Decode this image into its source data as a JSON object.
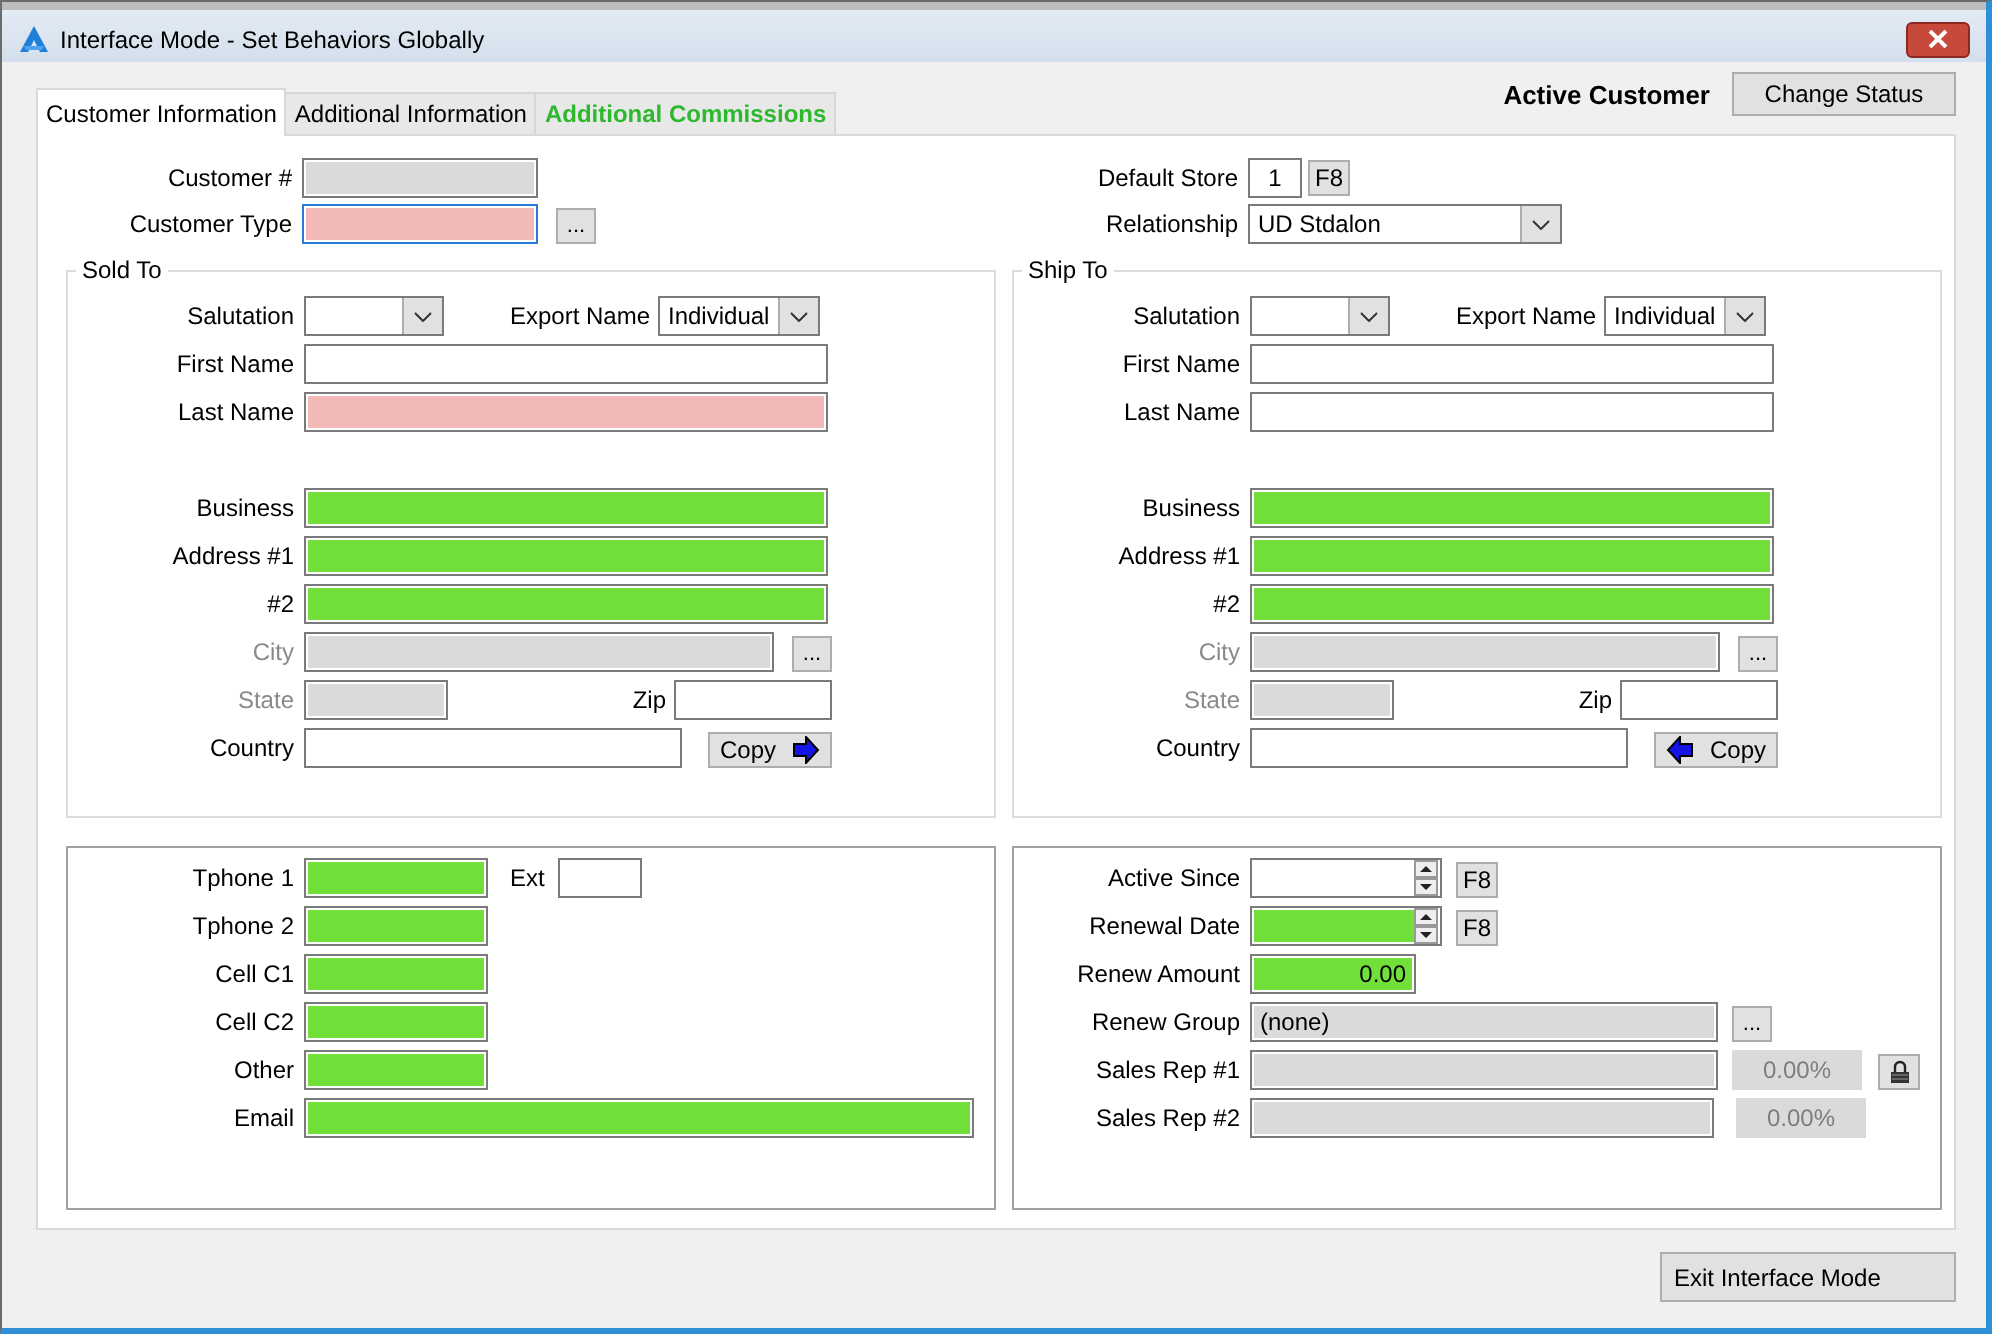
{
  "window": {
    "title": "Interface Mode - Set Behaviors Globally"
  },
  "tabs": [
    {
      "label": "Customer Information",
      "selected": true,
      "flagged": false
    },
    {
      "label": "Additional Information",
      "selected": false,
      "flagged": false
    },
    {
      "label": "Additional Commissions",
      "selected": false,
      "flagged": true
    }
  ],
  "header": {
    "status": "Active Customer",
    "change_status_button": "Change Status"
  },
  "account": {
    "customer_number": {
      "label": "Customer #",
      "disabled": true
    },
    "customer_type": {
      "label": "Customer Type",
      "required": true,
      "focused": true,
      "lookup_button": "..."
    },
    "default_store": {
      "label": "Default Store",
      "value": "1",
      "lookup_button": "F8"
    },
    "relationship": {
      "label": "Relationship",
      "value": "UD Stdalon"
    }
  },
  "sold_to": {
    "title": "Sold To",
    "salutation": {
      "label": "Salutation"
    },
    "export_name": {
      "label": "Export Name",
      "value": "Individual"
    },
    "first_name": {
      "label": "First Name"
    },
    "last_name": {
      "label": "Last Name",
      "required": true
    },
    "business": {
      "label": "Business",
      "flagged": true
    },
    "address_1": {
      "label": "Address #1",
      "flagged": true
    },
    "address_2": {
      "label": "#2",
      "flagged": true
    },
    "city": {
      "label": "City",
      "disabled": true,
      "label_dimmed": true,
      "lookup_button": "..."
    },
    "state": {
      "label": "State",
      "disabled": true,
      "label_dimmed": true
    },
    "zip": {
      "label": "Zip"
    },
    "country": {
      "label": "Country"
    },
    "copy_button": {
      "label": "Copy",
      "points_left": false
    }
  },
  "ship_to": {
    "title": "Ship To",
    "salutation": {
      "label": "Salutation"
    },
    "export_name": {
      "label": "Export Name",
      "value": "Individual"
    },
    "first_name": {
      "label": "First Name"
    },
    "last_name": {
      "label": "Last Name"
    },
    "business": {
      "label": "Business",
      "flagged": true
    },
    "address_1": {
      "label": "Address #1",
      "flagged": true
    },
    "address_2": {
      "label": "#2",
      "flagged": true
    },
    "city": {
      "label": "City",
      "disabled": true,
      "label_dimmed": true,
      "lookup_button": "..."
    },
    "state": {
      "label": "State",
      "disabled": true,
      "label_dimmed": true
    },
    "zip": {
      "label": "Zip"
    },
    "country": {
      "label": "Country"
    },
    "copy_button": {
      "label": "Copy",
      "points_left": true
    }
  },
  "contact": {
    "tphone_1": {
      "label": "Tphone 1",
      "flagged": true
    },
    "ext": {
      "label": "Ext"
    },
    "tphone_2": {
      "label": "Tphone 2",
      "flagged": true
    },
    "cell_c1": {
      "label": "Cell C1",
      "flagged": true
    },
    "cell_c2": {
      "label": "Cell C2",
      "flagged": true
    },
    "other": {
      "label": "Other",
      "flagged": true
    },
    "email": {
      "label": "Email",
      "flagged": true
    }
  },
  "renewal": {
    "active_since": {
      "label": "Active Since",
      "lookup_button": "F8"
    },
    "renewal_date": {
      "label": "Renewal Date",
      "flagged": true,
      "lookup_button": "F8"
    },
    "renew_amount": {
      "label": "Renew Amount",
      "value": "0.00",
      "flagged": true
    },
    "renew_group": {
      "label": "Renew Group",
      "value": "(none)",
      "disabled": true,
      "lookup_button": "..."
    },
    "sales_rep_1": {
      "label": "Sales Rep #1",
      "disabled": true,
      "percent": "0.00%",
      "locked": true
    },
    "sales_rep_2": {
      "label": "Sales Rep #2",
      "disabled": true,
      "percent": "0.00%"
    }
  },
  "exit_button": "Exit Interface Mode"
}
